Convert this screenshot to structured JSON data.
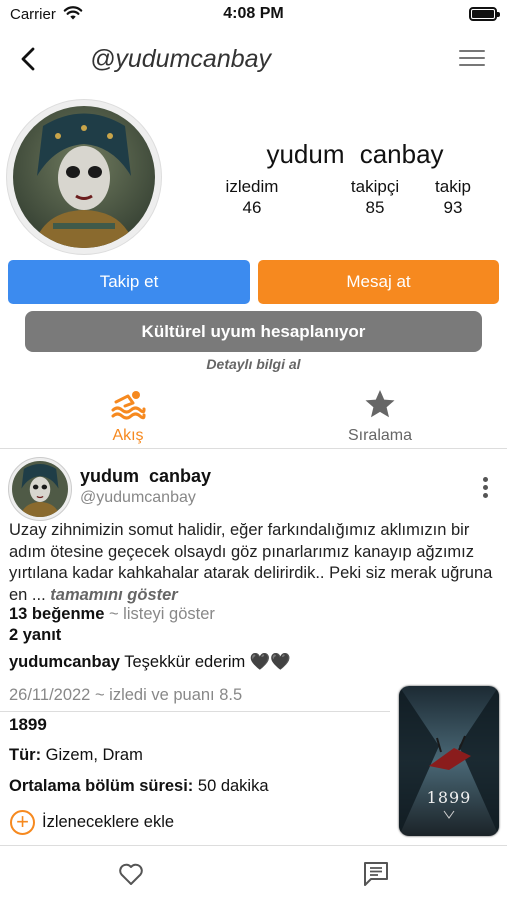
{
  "status_bar": {
    "carrier": "Carrier",
    "time": "4:08 PM"
  },
  "header": {
    "title": "@yudumcanbay"
  },
  "profile": {
    "name": "yudum  canbay",
    "stats": [
      {
        "label": "izledim",
        "value": "46"
      },
      {
        "label": "takipçi",
        "value": "85"
      },
      {
        "label": "takip",
        "value": "93"
      }
    ],
    "follow_label": "Takip et",
    "message_label": "Mesaj at",
    "culture_label": "Kültürel uyum hesaplanıyor",
    "detail_label": "Detaylı bilgi al"
  },
  "tabs": [
    {
      "label": "Akış",
      "icon": "swimmer-icon",
      "active": true
    },
    {
      "label": "Sıralama",
      "icon": "star-icon",
      "active": false
    }
  ],
  "post": {
    "user": "yudum  canbay",
    "handle": "@yudumcanbay",
    "text": "Uzay zihnimizin somut halidir, eğer farkındalığımız aklımızın bir adım ötesine geçecek olsaydı göz pınarlarımız kanayıp ağzımız yırtılana kadar kahkahalar atarak delirirdik.. Peki siz merak uğruna en ... ",
    "more_label": "tamamını göster",
    "likes_label": "13 beğenme",
    "likes_list_label": " ~ listeyi göster",
    "replies_label": "2 yanıt",
    "reply_user": "yudumcanbay",
    "reply_text": " Teşekkür ederim 🖤🖤",
    "watch_meta": "26/11/2022 ~ izledi ve puanı 8.5",
    "show_title": "1899",
    "genre_label": "Tür:",
    "genre_value": " Gizem, Dram",
    "duration_label": "Ortalama bölüm süresi:",
    "duration_value": " 50 dakika",
    "watchlist_label": "İzleneceklere ekle",
    "poster_text": "1899"
  },
  "colors": {
    "accent": "#f6891f",
    "blue": "#3c8bef",
    "gray": "#7a7a7a"
  }
}
